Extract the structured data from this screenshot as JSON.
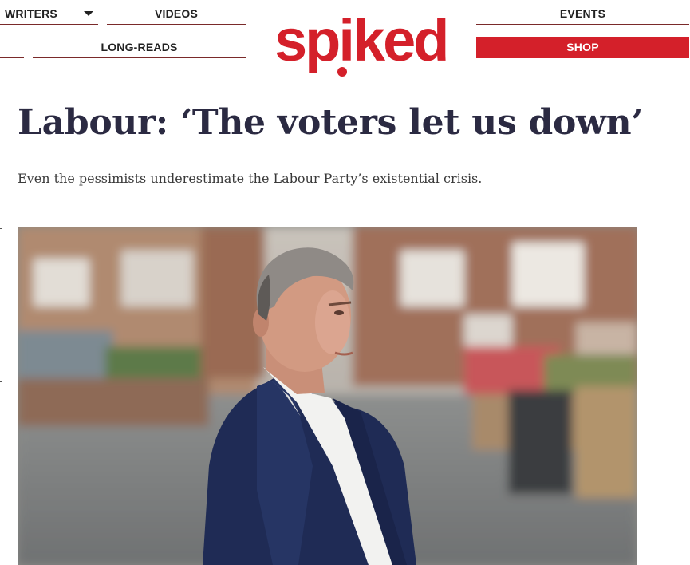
{
  "nav": {
    "writers": "WRITERS",
    "videos": "VIDEOS",
    "events": "EVENTS",
    "long_reads": "LONG-READS",
    "shop": "SHOP"
  },
  "logo": {
    "text": "spiked",
    "color": "#d4202a"
  },
  "article": {
    "headline": "Labour: ‘The voters let us down’",
    "standfirst": "Even the pessimists underestimate the Labour Party’s existential crisis."
  },
  "colors": {
    "accent": "#d4202a",
    "headline": "#2b2a42"
  },
  "icons": {
    "writers_menu": "caret-down-icon"
  }
}
